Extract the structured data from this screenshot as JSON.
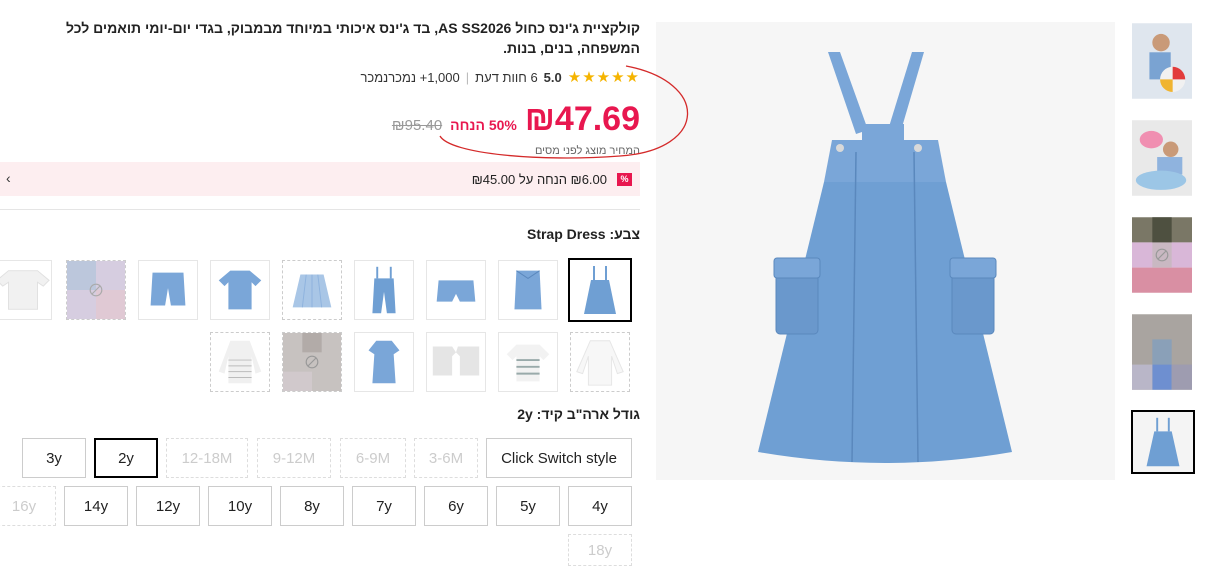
{
  "product": {
    "title": "קולקציית ג'ינס כחול AS SS2026, בד ג'ינס איכותי במיוחד מבמבוק, בגדי יום-יומי תואמים לכל המשפחה, בנים, בנות.",
    "stars": "★★★★★",
    "rating": "5.0",
    "reviews": "6 חוות דעת",
    "sold": "1,000+ נמכרנמכר",
    "price": "₪47.69",
    "discount": "50% הנחה",
    "old_price": "₪95.40",
    "tax_note": "המחיר מוצג לפני מסים"
  },
  "promo": {
    "badge": "%",
    "text": "₪6.00 הנחה על ₪45.00",
    "chevron": "›"
  },
  "color": {
    "label": "צבע: Strap Dress"
  },
  "size": {
    "label": "גודל ארה\"ב קיד: 2y",
    "options_row1": [
      "Click Switch style",
      "3-6M",
      "6-9M",
      "9-12M",
      "12-18M",
      "2y",
      "3y"
    ],
    "options_row2": [
      "4y",
      "5y",
      "6y",
      "7y",
      "8y",
      "10y",
      "12y",
      "14y",
      "16y"
    ],
    "options_row3": [
      "18y"
    ]
  },
  "colors": {
    "accent": "#e8174f",
    "denim": "#6f9fd3"
  }
}
